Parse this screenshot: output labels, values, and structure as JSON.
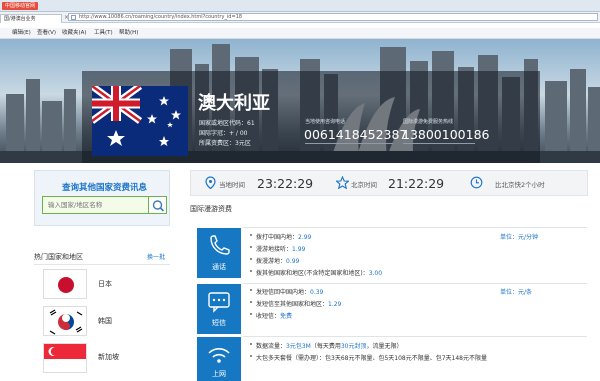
{
  "browser": {
    "carrier_badge": "中国移动官网",
    "url": "http://www.10086.cn/roaming/country/index.html?country_id=18",
    "tab_title": "国/港澳台业务",
    "menu": [
      "编辑(E)",
      "查看(V)",
      "收藏夹(A)",
      "工具(T)",
      "帮助(H)"
    ]
  },
  "banner": {
    "country": "澳大利亚",
    "code_line": "国家或地区代码：61",
    "network_line": "国际字冠：+ / 00",
    "zone_line": "所属资费区：3元区",
    "hotline1_label": "当地使用咨询电话",
    "hotline1_number": "0061418452387",
    "hotline2_label": "国际漫游免费服务热线",
    "hotline2_number": "13800100186"
  },
  "search": {
    "title": "查询其他国家资费讯息",
    "placeholder": "输入国家/地区名称"
  },
  "hot": {
    "title": "热门国家和地区",
    "more": "换一批",
    "items": [
      {
        "name": "日本"
      },
      {
        "name": "韩国"
      },
      {
        "name": "新加坡"
      }
    ]
  },
  "timebar": {
    "local_label": "当地时间",
    "local_time": "23:22:29",
    "beijing_label": "北京时间",
    "beijing_time": "21:22:29",
    "diff": "比北京快2个小时"
  },
  "section_title": "国际漫游资费",
  "fees": {
    "call": {
      "label": "通话",
      "unit": "单位：元/分钟",
      "lines": [
        {
          "text": "拨打中国内地：",
          "value": "2.99"
        },
        {
          "text": "漫游地接听：",
          "value": "1.99"
        },
        {
          "text": "拨漫游地：",
          "value": "0.99"
        },
        {
          "text": "拨其他国家和地区(不含特定国家和地区)：",
          "value": "3.00"
        }
      ]
    },
    "sms": {
      "label": "短信",
      "unit": "单位：元/条",
      "lines": [
        {
          "text": "发短信回中国内地：",
          "value": "0.39"
        },
        {
          "text": "发短信至其他国家和地区：",
          "value": "1.29"
        },
        {
          "text": "收短信：",
          "value": "免费"
        }
      ]
    },
    "data": {
      "label": "上网",
      "line1_prefix": "数据流量：",
      "line1_value": "3元包3M",
      "line1_mid": "（每天费用",
      "line1_cap": "30元封顶",
      "line1_suffix": "，流量无限）",
      "line2": "大包多天套餐（需办理）：包3天68元不限量、包5天108元不限量、包7天148元不限量"
    }
  },
  "colors": {
    "accent_blue": "#1678c2",
    "link_blue": "#1a73c9",
    "search_green": "#6ab24a"
  }
}
